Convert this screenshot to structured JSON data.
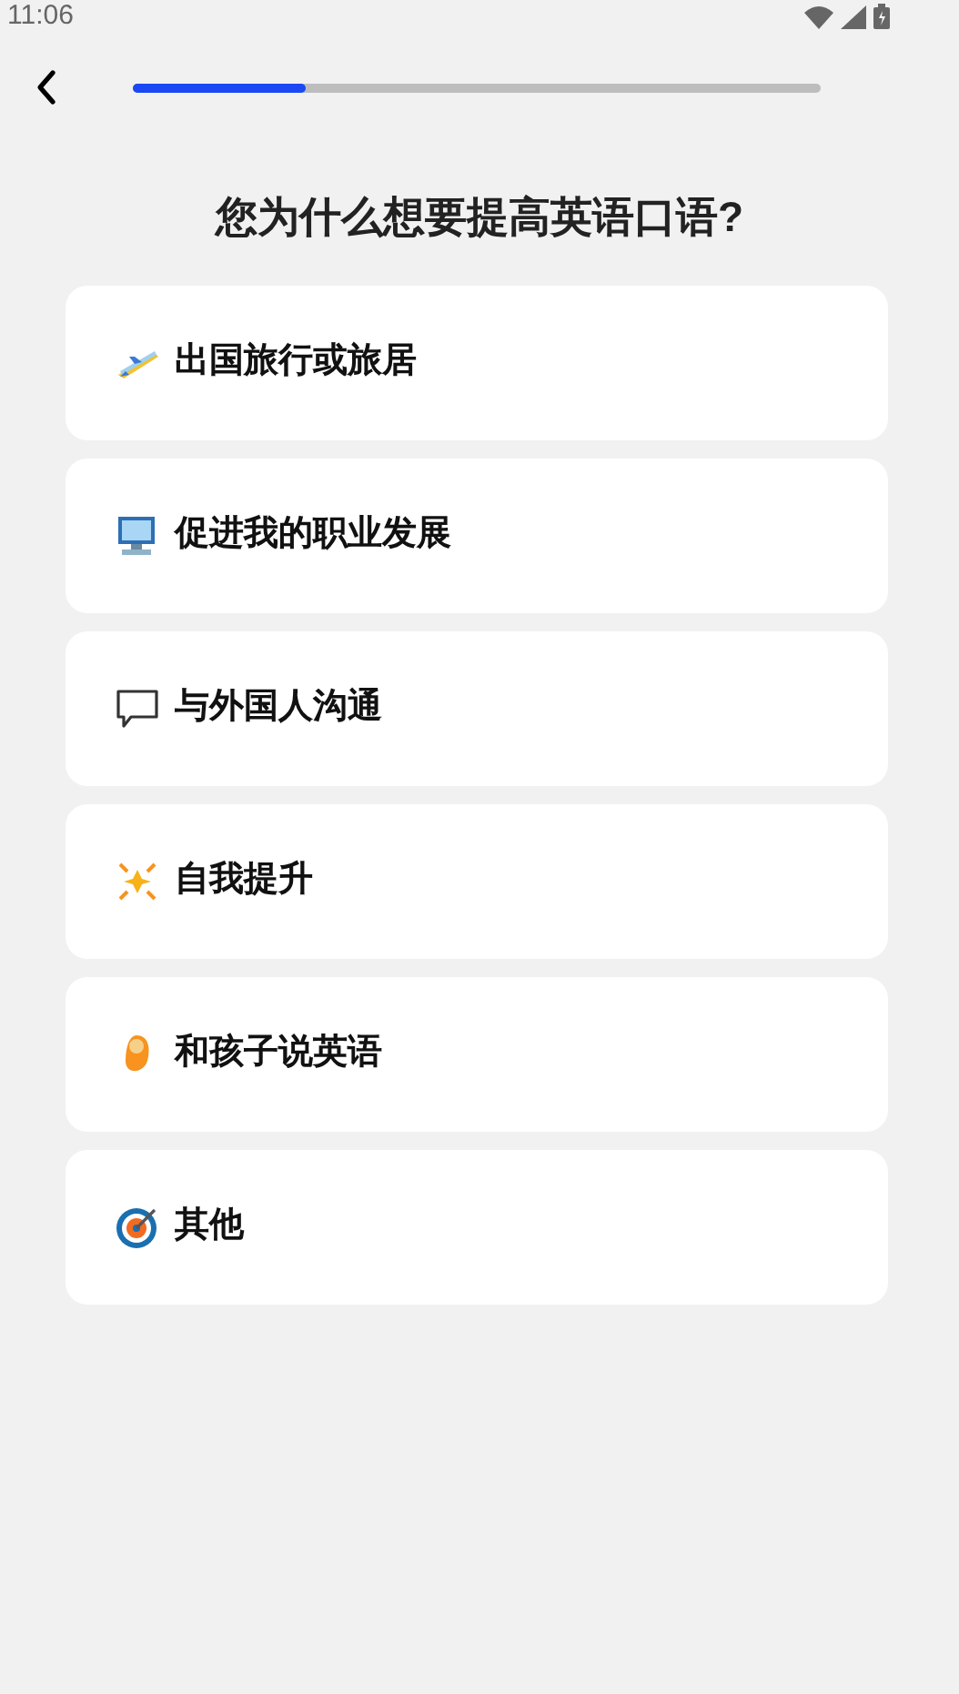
{
  "status_bar": {
    "time": "11:06"
  },
  "progress": {
    "level": 0.25
  },
  "title": "您为什么想要提高英语口语?",
  "options": [
    {
      "kind": "plane",
      "label": "出国旅行或旅居"
    },
    {
      "kind": "computer",
      "label": "促进我的职业发展"
    },
    {
      "kind": "speech",
      "label": "与外国人沟通"
    },
    {
      "kind": "sparkle",
      "label": "自我提升"
    },
    {
      "kind": "baby",
      "label": "和孩子说英语"
    },
    {
      "kind": "target",
      "label": "其他"
    }
  ]
}
